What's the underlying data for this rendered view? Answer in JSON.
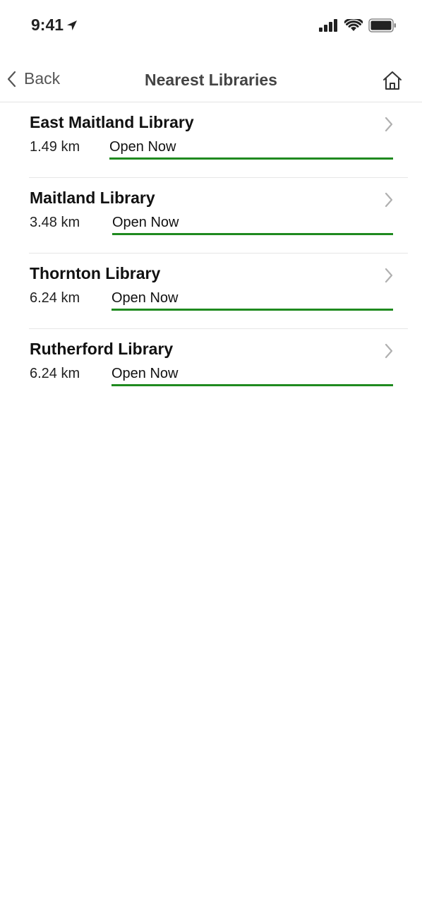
{
  "status_bar": {
    "time": "9:41",
    "icons": [
      "location-arrow-icon",
      "cellular-signal-icon",
      "wifi-icon",
      "battery-icon"
    ]
  },
  "nav": {
    "back_label": "Back",
    "title": "Nearest Libraries",
    "home_icon": "home-icon"
  },
  "colors": {
    "status_open": "#1f8a1f",
    "chevron": "#b0b0b0"
  },
  "libraries": [
    {
      "name": "East Maitland Library",
      "distance": "1.49 km",
      "status": "Open Now"
    },
    {
      "name": "Maitland Library",
      "distance": "3.48 km",
      "status": "Open Now"
    },
    {
      "name": "Thornton Library",
      "distance": "6.24 km",
      "status": "Open Now"
    },
    {
      "name": "Rutherford Library",
      "distance": "6.24 km",
      "status": "Open Now"
    }
  ]
}
